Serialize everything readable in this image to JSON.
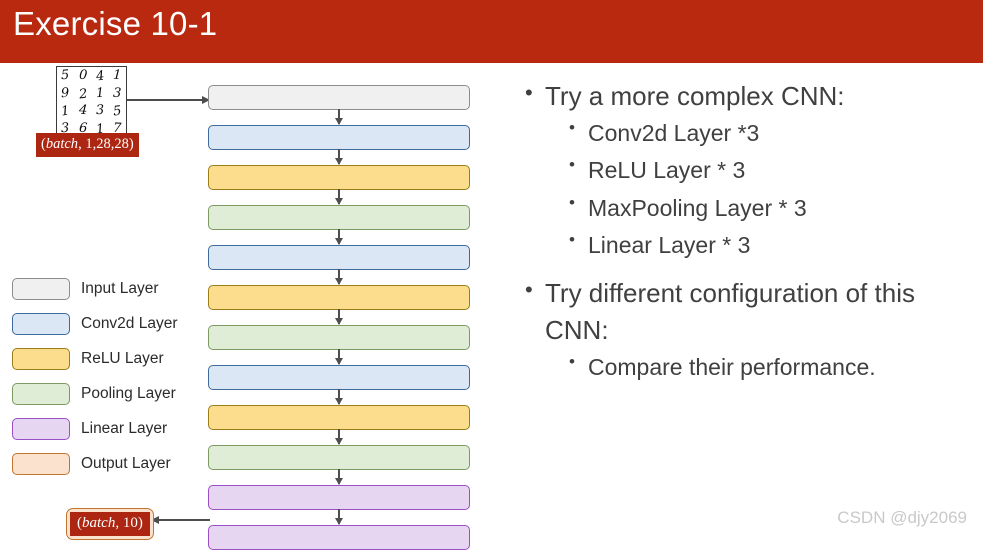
{
  "slide": {
    "title": "Exercise 10-1",
    "title_bar_color": "#b8290f",
    "background_color": "#ffffff",
    "watermark": "CSDN @djy2069"
  },
  "diagram": {
    "input_sample": {
      "name": "mnist-digit-grid",
      "digits": [
        "5",
        "0",
        "4",
        "1",
        "9",
        "2",
        "1",
        "3",
        "1",
        "4",
        "3",
        "5",
        "3",
        "6",
        "1",
        "7"
      ]
    },
    "input_shape_tag": {
      "prefix": "(",
      "italic": "batch",
      "suffix": ", 1,28,28)",
      "full": "(batch, 1,28,28)",
      "text_color": "#ffffff",
      "background_color": "#ac2611"
    },
    "output_shape_tag": {
      "prefix": "(",
      "italic": "batch",
      "suffix": ", 10)",
      "full": "(batch, 10)",
      "text_color": "#ffffff",
      "background_color": "#ac2611",
      "border_color": "#c0762f"
    },
    "nodes": [
      {
        "type": "input",
        "label": "Input Layer",
        "fill": "#f0f0f0",
        "stroke": "#8c8c8c"
      },
      {
        "type": "conv",
        "label": "Conv2d Layer",
        "fill": "#dbe7f4",
        "stroke": "#3d6b9e"
      },
      {
        "type": "relu",
        "label": "ReLU Layer",
        "fill": "#fcdd8d",
        "stroke": "#9c7d16"
      },
      {
        "type": "pool",
        "label": "Pooling Layer",
        "fill": "#e0edd6",
        "stroke": "#7d9a63"
      },
      {
        "type": "conv",
        "label": "Conv2d Layer",
        "fill": "#dbe7f4",
        "stroke": "#3d6b9e"
      },
      {
        "type": "relu",
        "label": "ReLU Layer",
        "fill": "#fcdd8d",
        "stroke": "#9c7d16"
      },
      {
        "type": "pool",
        "label": "Pooling Layer",
        "fill": "#e0edd6",
        "stroke": "#7d9a63"
      },
      {
        "type": "conv",
        "label": "Conv2d Layer",
        "fill": "#dbe7f4",
        "stroke": "#3d6b9e"
      },
      {
        "type": "relu",
        "label": "ReLU Layer",
        "fill": "#fcdd8d",
        "stroke": "#9c7d16"
      },
      {
        "type": "pool",
        "label": "Pooling Layer",
        "fill": "#e0edd6",
        "stroke": "#7d9a63"
      },
      {
        "type": "linear",
        "label": "Linear Layer",
        "fill": "#e6d6f2",
        "stroke": "#9b4fc7"
      },
      {
        "type": "linear",
        "label": "Linear Layer",
        "fill": "#e6d6f2",
        "stroke": "#9b4fc7"
      }
    ]
  },
  "legend": {
    "items": [
      {
        "label": "Input Layer",
        "fill": "#f0f0f0",
        "stroke": "#8c8c8c"
      },
      {
        "label": "Conv2d Layer",
        "fill": "#dbe7f4",
        "stroke": "#3d6b9e"
      },
      {
        "label": "ReLU Layer",
        "fill": "#fcdd8d",
        "stroke": "#9c7d16"
      },
      {
        "label": "Pooling Layer",
        "fill": "#e0edd6",
        "stroke": "#7d9a63"
      },
      {
        "label": "Linear Layer",
        "fill": "#e6d6f2",
        "stroke": "#9b4fc7"
      },
      {
        "label": "Output Layer",
        "fill": "#fbe2ce",
        "stroke": "#c0762f"
      }
    ]
  },
  "content": {
    "bullets": [
      {
        "level": 1,
        "text": "Try a more complex CNN:"
      },
      {
        "level": 2,
        "text": "Conv2d Layer *3"
      },
      {
        "level": 2,
        "text": "ReLU Layer * 3"
      },
      {
        "level": 2,
        "text": "MaxPooling Layer * 3"
      },
      {
        "level": 2,
        "text": "Linear Layer * 3"
      },
      {
        "level": 1,
        "text": "Try different configuration of this CNN:"
      },
      {
        "level": 2,
        "text": "Compare their performance."
      }
    ]
  }
}
